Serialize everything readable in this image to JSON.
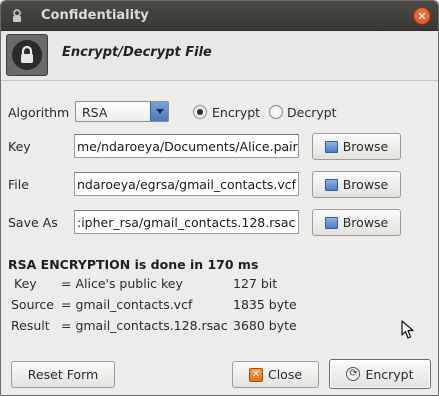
{
  "window": {
    "title": "Confidentiality"
  },
  "header": {
    "title": "Encrypt/Decrypt File"
  },
  "algorithm": {
    "label": "Algorithm",
    "selected": "RSA",
    "modes": [
      {
        "label": "Encrypt",
        "checked": true
      },
      {
        "label": "Decrypt",
        "checked": false
      }
    ]
  },
  "fields": {
    "key": {
      "label": "Key",
      "value": "me/ndaroeya/Documents/Alice.pair"
    },
    "file": {
      "label": "File",
      "value": "ndaroeya/egrsa/gmail_contacts.vcf"
    },
    "save_as": {
      "label": "Save As",
      "value": ":ipher_rsa/gmail_contacts.128.rsac"
    },
    "browse_label": "Browse"
  },
  "result": {
    "headline": "RSA ENCRYPTION is done in 170 ms",
    "rows": [
      {
        "name": "Key",
        "value": "= Alice's public key",
        "size": "127 bit"
      },
      {
        "name": "Source",
        "value": "= gmail_contacts.vcf",
        "size": "1835 byte"
      },
      {
        "name": "Result",
        "value": "= gmail_contacts.128.rsac",
        "size": "3680 byte"
      }
    ]
  },
  "buttons": {
    "reset": "Reset Form",
    "close": "Close",
    "encrypt": "Encrypt"
  }
}
